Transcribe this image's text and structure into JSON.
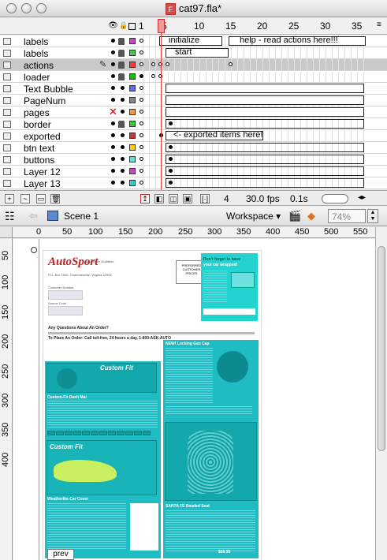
{
  "window": {
    "title": "cat97.fla*",
    "file_icon": "flash-document-icon"
  },
  "timeline": {
    "frame_numbers": [
      "1",
      "5",
      "10",
      "15",
      "20",
      "25",
      "30",
      "35"
    ],
    "header_icons": [
      "eye-icon",
      "lock-icon",
      "outline-icon"
    ],
    "layers": [
      {
        "name": "labels",
        "frame_label": "initialize",
        "frame_label2": "help - read actions here!!!"
      },
      {
        "name": "labels",
        "frame_label": "start"
      },
      {
        "name": "actions",
        "selected": true
      },
      {
        "name": "loader"
      },
      {
        "name": "Text Bubble"
      },
      {
        "name": "PageNum"
      },
      {
        "name": "pages",
        "hidden": true
      },
      {
        "name": "border"
      },
      {
        "name": "exported",
        "frame_label": "<- exported items here!"
      },
      {
        "name": "btn text"
      },
      {
        "name": "buttons"
      },
      {
        "name": "Layer 12"
      },
      {
        "name": "Layer 13"
      }
    ],
    "layer_colors": [
      "#cc44cc",
      "#44cc44",
      "#ff3333",
      "#00cc00",
      "#6666ff",
      "#888888",
      "#ff9933",
      "#33cc33",
      "#cc3333",
      "#ffcc00",
      "#66dddd",
      "#cc44cc",
      "#33cccc"
    ],
    "footer": {
      "current_frame": "4",
      "fps": "30.0 fps",
      "elapsed": "0.1s"
    }
  },
  "scene": {
    "name": "Scene 1",
    "workspace_label": "Workspace",
    "zoom": "74%"
  },
  "rulers": {
    "horizontal": [
      "0",
      "50",
      "100",
      "150",
      "200",
      "250",
      "300",
      "350",
      "400",
      "450",
      "500",
      "550"
    ],
    "vertical": [
      "50",
      "100",
      "150",
      "200",
      "250",
      "300",
      "350",
      "400"
    ]
  },
  "catalog": {
    "brand": "AutoSport",
    "tagline": "Automotive Outfitters",
    "address": "P.O. Box 1900, Charlottesville, Virginia 22906",
    "customer_number_label": "Customer Number",
    "source_code_label": "Source Code",
    "questions_line": "Any Questions About An Order?",
    "phone_line": "To Place An Order: Call toll-free, 24 hours a day, 1-800-ASK-AUTO",
    "reminder_lines": [
      "PREFERRED",
      "CUSTOMER",
      "PRICES"
    ],
    "promo_title": "Don't forget to have",
    "promo_subtitle": "your car wrapped!",
    "custom_fit": "Custom Fit",
    "dash_mat_head": "Custom-Fit Dash Mat",
    "key_chain_head": "NEW! Locking Gas Cap",
    "cover_head": "Weatherlite Car Cover",
    "seat_head": "SANTA FE Beaded Seat",
    "order_code": "$59.95"
  },
  "buttons": {
    "prev": "prev"
  }
}
